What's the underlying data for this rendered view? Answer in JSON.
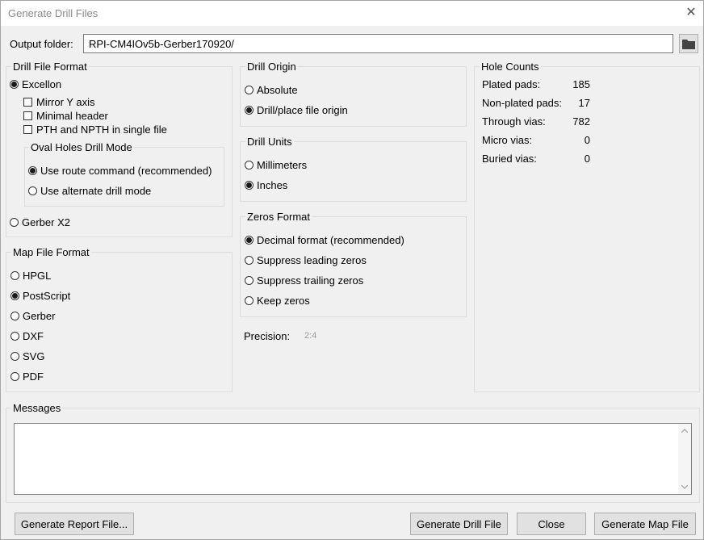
{
  "window": {
    "title": "Generate Drill Files"
  },
  "output": {
    "label": "Output folder:",
    "value": "RPI-CM4IOv5b-Gerber170920/"
  },
  "drill_file_format": {
    "title": "Drill File Format",
    "excellon": "Excellon",
    "mirror_y": "Mirror Y axis",
    "minimal_header": "Minimal header",
    "pth_npth": "PTH and NPTH in single file",
    "oval_title": "Oval Holes Drill Mode",
    "oval_route": "Use route command (recommended)",
    "oval_alt": "Use alternate drill mode",
    "gerber_x2": "Gerber X2"
  },
  "map_file_format": {
    "title": "Map File Format",
    "options": [
      "HPGL",
      "PostScript",
      "Gerber",
      "DXF",
      "SVG",
      "PDF"
    ],
    "selected": "PostScript"
  },
  "drill_origin": {
    "title": "Drill Origin",
    "absolute": "Absolute",
    "drill_place": "Drill/place file origin"
  },
  "drill_units": {
    "title": "Drill Units",
    "mm": "Millimeters",
    "inches": "Inches"
  },
  "zeros_format": {
    "title": "Zeros Format",
    "decimal": "Decimal format (recommended)",
    "suppress_leading": "Suppress leading zeros",
    "suppress_trailing": "Suppress trailing zeros",
    "keep": "Keep zeros"
  },
  "precision": {
    "label": "Precision:",
    "value": "2:4"
  },
  "hole_counts": {
    "title": "Hole Counts",
    "rows": [
      {
        "label": "Plated pads:",
        "value": "185"
      },
      {
        "label": "Non-plated pads:",
        "value": "17"
      },
      {
        "label": "Through vias:",
        "value": "782"
      },
      {
        "label": "Micro vias:",
        "value": "0"
      },
      {
        "label": "Buried vias:",
        "value": "0"
      }
    ]
  },
  "messages": {
    "title": "Messages",
    "value": ""
  },
  "buttons": {
    "report": "Generate Report File...",
    "drill": "Generate Drill File",
    "close": "Close",
    "map": "Generate Map File"
  },
  "icons": {
    "folder": "folder-icon",
    "close": "close-icon",
    "scroll_up": "chevron-up-icon",
    "scroll_down": "chevron-down-icon"
  }
}
